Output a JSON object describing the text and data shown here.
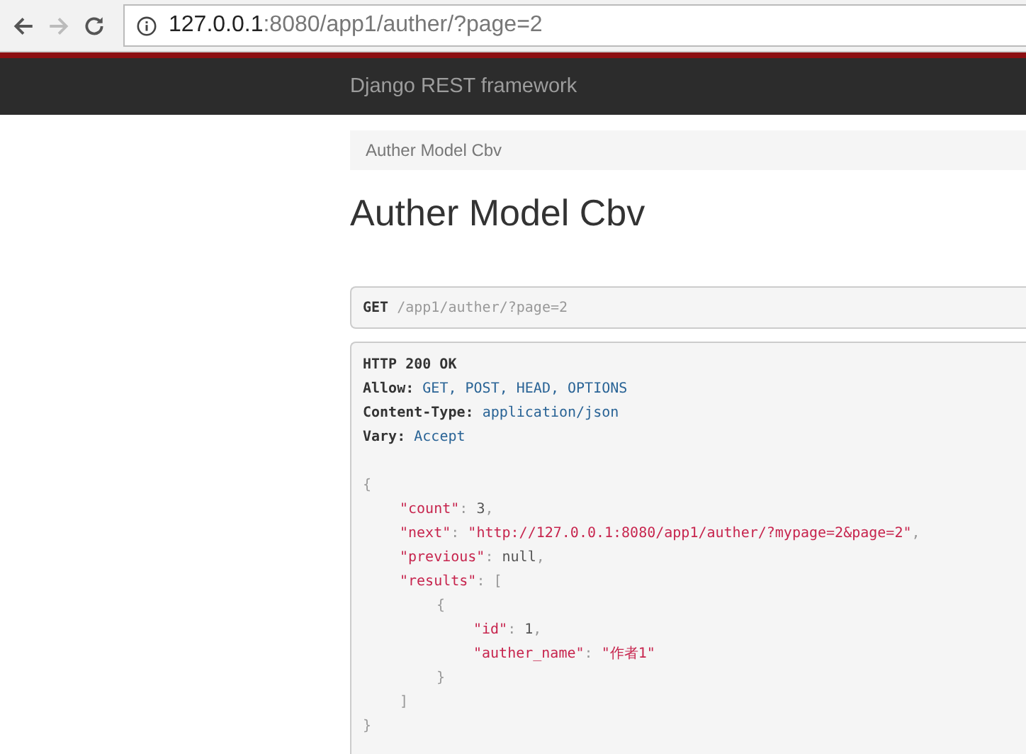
{
  "browser": {
    "url_host": "127.0.0.1",
    "url_rest": ":8080/app1/auther/?page=2"
  },
  "navbar": {
    "brand": "Django REST framework"
  },
  "breadcrumb": [
    "Auther Model Cbv"
  ],
  "title": "Auther Model Cbv",
  "request": {
    "method": "GET",
    "path": "/app1/auther/?page=2"
  },
  "response": {
    "status": "HTTP 200 OK",
    "headers": [
      {
        "name": "Allow:",
        "value": "GET, POST, HEAD, OPTIONS"
      },
      {
        "name": "Content-Type:",
        "value": "application/json"
      },
      {
        "name": "Vary:",
        "value": "Accept"
      }
    ],
    "body": [
      {
        "tokens": [
          {
            "kind": "punct",
            "text": "{"
          }
        ],
        "children": [
          {
            "tokens": [
              {
                "kind": "key",
                "text": "\"count\""
              },
              {
                "kind": "punct",
                "text": ": "
              },
              {
                "kind": "lit",
                "text": "3"
              },
              {
                "kind": "punct",
                "text": ","
              }
            ]
          },
          {
            "tokens": [
              {
                "kind": "key",
                "text": "\"next\""
              },
              {
                "kind": "punct",
                "text": ": "
              },
              {
                "kind": "str",
                "text": "\"http://127.0.0.1:8080/app1/auther/?mypage=2&page=2\""
              },
              {
                "kind": "punct",
                "text": ","
              }
            ]
          },
          {
            "tokens": [
              {
                "kind": "key",
                "text": "\"previous\""
              },
              {
                "kind": "punct",
                "text": ": "
              },
              {
                "kind": "lit",
                "text": "null"
              },
              {
                "kind": "punct",
                "text": ","
              }
            ]
          },
          {
            "tokens": [
              {
                "kind": "key",
                "text": "\"results\""
              },
              {
                "kind": "punct",
                "text": ": ["
              }
            ],
            "children": [
              {
                "tokens": [
                  {
                    "kind": "punct",
                    "text": "{"
                  }
                ],
                "children": [
                  {
                    "tokens": [
                      {
                        "kind": "key",
                        "text": "\"id\""
                      },
                      {
                        "kind": "punct",
                        "text": ": "
                      },
                      {
                        "kind": "lit",
                        "text": "1"
                      },
                      {
                        "kind": "punct",
                        "text": ","
                      }
                    ]
                  },
                  {
                    "tokens": [
                      {
                        "kind": "key",
                        "text": "\"auther_name\""
                      },
                      {
                        "kind": "punct",
                        "text": ": "
                      },
                      {
                        "kind": "str",
                        "text": "\"作者1\""
                      }
                    ]
                  }
                ]
              },
              {
                "tokens": [
                  {
                    "kind": "punct",
                    "text": "}"
                  }
                ]
              }
            ]
          },
          {
            "tokens": [
              {
                "kind": "punct",
                "text": "]"
              }
            ]
          }
        ]
      },
      {
        "tokens": [
          {
            "kind": "punct",
            "text": "}"
          }
        ]
      }
    ]
  }
}
